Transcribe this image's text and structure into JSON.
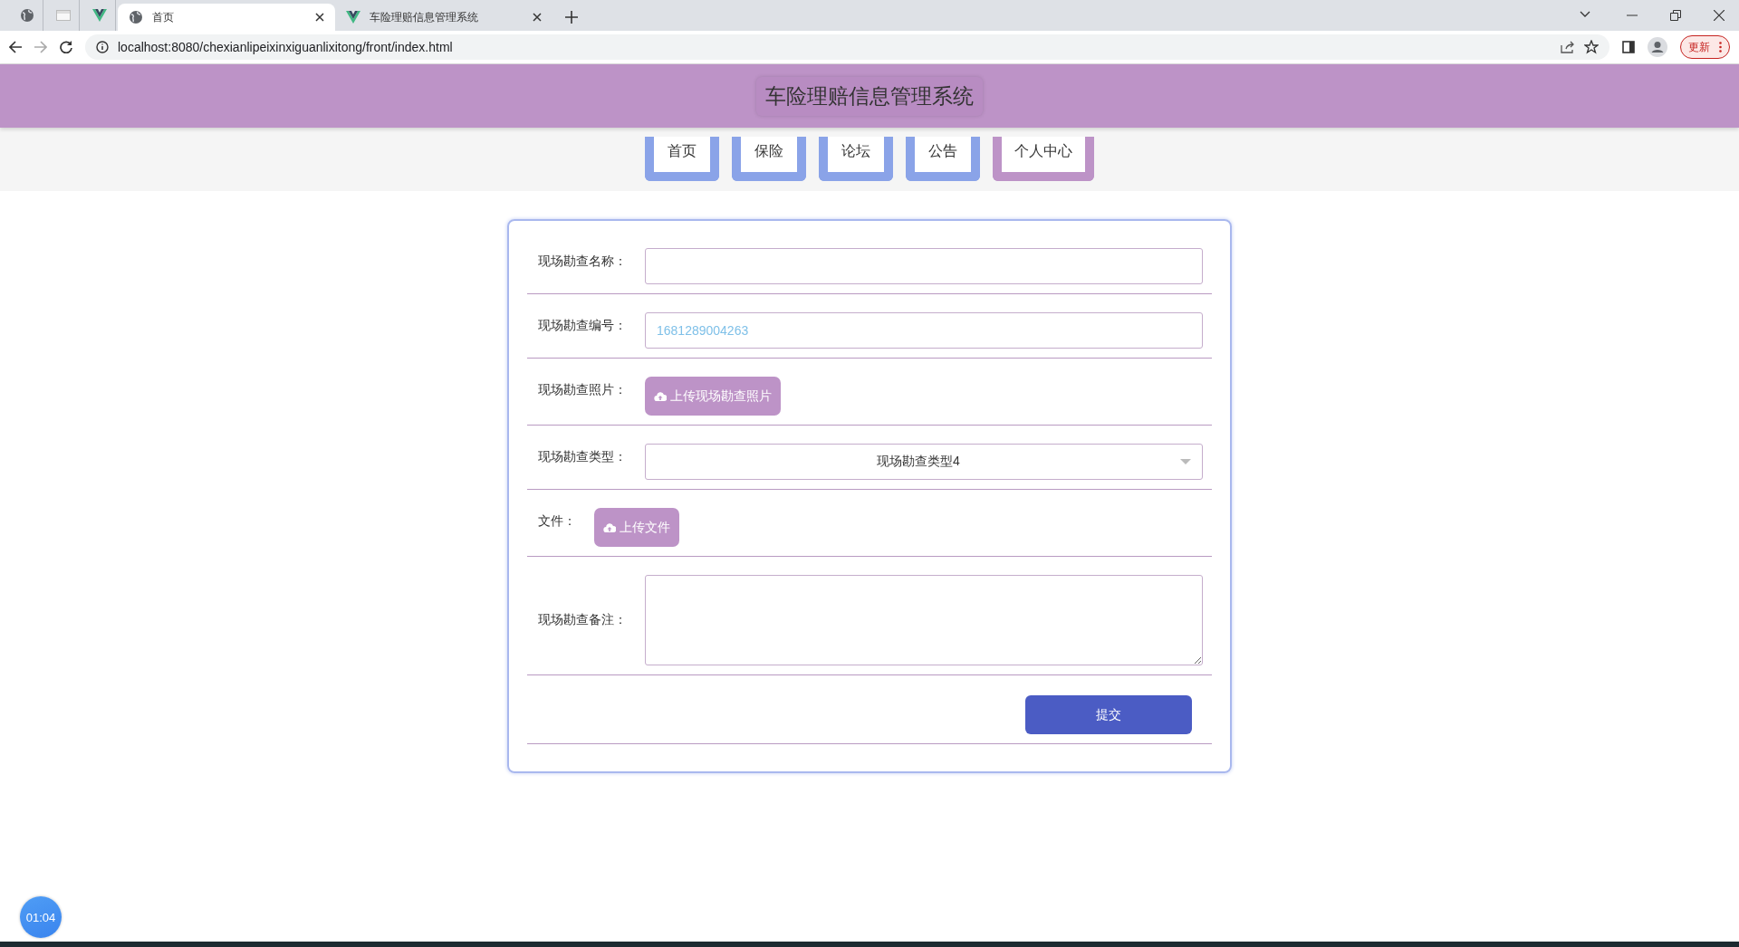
{
  "browser": {
    "tabs": [
      {
        "kind": "pinned",
        "selected": false
      },
      {
        "kind": "pinned",
        "selected": false
      },
      {
        "kind": "pinned",
        "selected": false
      },
      {
        "kind": "page",
        "title": "首页",
        "selected": true
      },
      {
        "kind": "page",
        "title": "车险理赔信息管理系统",
        "selected": false
      }
    ],
    "address": "localhost:8080/chexianlipeixinxiguanlixitong/front/index.html",
    "update_button": "更新"
  },
  "header": {
    "title": "车险理赔信息管理系统"
  },
  "nav": [
    {
      "label": "首页",
      "selected": false
    },
    {
      "label": "保险",
      "selected": false
    },
    {
      "label": "论坛",
      "selected": false
    },
    {
      "label": "公告",
      "selected": false
    },
    {
      "label": "个人中心",
      "selected": true
    }
  ],
  "form": {
    "fields": [
      {
        "kind": "text",
        "label": "现场勘查名称："
      },
      {
        "kind": "text",
        "label": "现场勘查编号：",
        "value": "1681289004263"
      },
      {
        "kind": "upload",
        "label": "现场勘查照片：",
        "button": "上传现场勘查照片"
      },
      {
        "kind": "select",
        "label": "现场勘查类型：",
        "value": "现场勘查类型4"
      },
      {
        "kind": "upload",
        "label": "文件：",
        "button": "上传文件"
      },
      {
        "kind": "textarea",
        "label": "现场勘查备注："
      }
    ],
    "submit": "提交"
  },
  "timer": "01:04"
}
